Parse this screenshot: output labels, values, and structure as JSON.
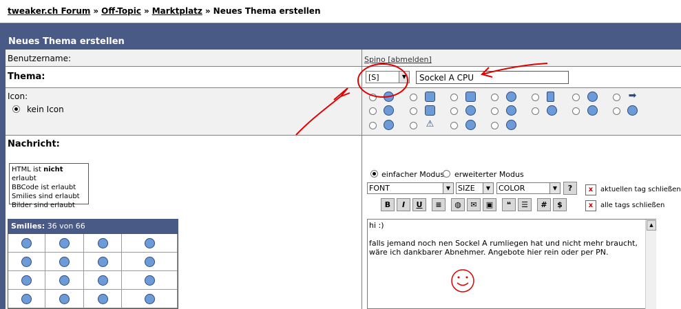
{
  "breadcrumb": {
    "forum": "tweaker.ch Forum",
    "sep1": "»",
    "section": "Off-Topic",
    "sep2": "»",
    "sub": "Marktplatz",
    "sep3": "»",
    "current": "Neues Thema erstellen"
  },
  "form": {
    "header": "Neues Thema erstellen",
    "username_label": "Benutzername:",
    "username_value": "Spino",
    "logout_link": "[abmelden]",
    "thema_label": "Thema:",
    "prefix_value": "[S]",
    "title_value": "Sockel A CPU",
    "icon_label": "Icon:",
    "no_icon_label": "kein Icon",
    "message_label": "Nachricht:"
  },
  "rules": {
    "html_pre": "HTML ist ",
    "html_bold": "nicht",
    "html_post": " erlaubt",
    "bbcode": "BBCode ist erlaubt",
    "smilies": "Smilies sind erlaubt",
    "images": "Bilder sind erlaubt"
  },
  "smilies_box": {
    "title": "Smilies:",
    "count": "36 von 66"
  },
  "editor": {
    "mode_simple": "einfacher Modus",
    "mode_advanced": "erweiterter Modus",
    "font": "FONT",
    "size": "SIZE",
    "color": "COLOR",
    "close_current": "aktuellen tag schließen",
    "close_all": "alle tags schließen",
    "btn_bold": "B",
    "btn_italic": "I",
    "btn_underline": "U",
    "btn_hash": "#",
    "btn_dollar": "$",
    "message_line1": "hi :)",
    "message_line2": "falls jemand noch nen Sockel A rumliegen hat und nicht mehr braucht,",
    "message_line3": "wäre ich dankbarer Abnehmer. Angebote hier rein oder per PN."
  },
  "colors": {
    "header_bg": "#4a5a87",
    "annotation_red": "#e00000",
    "smiley_blue": "#6d9bd8"
  }
}
